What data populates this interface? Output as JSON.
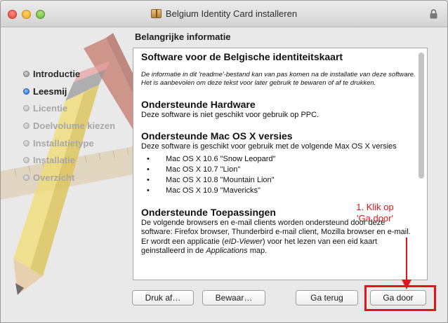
{
  "window": {
    "title": "Belgium Identity Card installeren"
  },
  "heading": "Belangrijke informatie",
  "sidebar": {
    "steps": [
      {
        "label": "Introductie",
        "state": "done"
      },
      {
        "label": "Leesmij",
        "state": "active"
      },
      {
        "label": "Licentie",
        "state": "future"
      },
      {
        "label": "Doelvolume kiezen",
        "state": "future"
      },
      {
        "label": "Installatietype",
        "state": "future"
      },
      {
        "label": "Installatie",
        "state": "future"
      },
      {
        "label": "Overzicht",
        "state": "future"
      }
    ]
  },
  "readme": {
    "title": "Software voor de Belgische identiteitskaart",
    "intro": "De informatie in dit 'readme'-bestand kan van pas komen na de installatie van deze software. Het is aanbevolen om deze tekst voor later gebruik te bewaren of af te drukken.",
    "hardware_heading": "Ondersteunde Hardware",
    "hardware_text": "Deze software is niet geschikt voor gebruik op PPC.",
    "macos_heading": "Ondersteunde Mac OS X versies",
    "macos_text": "Deze software is geschikt voor gebruik met de volgende Max OS X versies",
    "macos_versions": [
      "Mac OS X 10.6 \"Snow Leopard\"",
      "Mac OS X 10.7 \"Lion\"",
      "Mac OS X 10.8 \"Mountain Lion\"",
      "Mac OS X 10.9 \"Mavericks\""
    ],
    "apps_heading": "Ondersteunde Toepassingen",
    "apps_text": "De volgende browsers en e-mail clients worden ondersteund door deze software: Firefox browser, Thunderbird e-mail client, Mozilla browser en e-mail.",
    "apps_text2_pre": "Er wordt een applicatie (",
    "apps_text2_em": "eID-Viewer",
    "apps_text2_mid": ") voor het lezen van een eid kaart geinstalleerd in de ",
    "apps_text2_em2": "Applications",
    "apps_text2_post": " map."
  },
  "annotation": {
    "line1": "1. Klik op",
    "line2": "'Ga door'",
    "color": "#e3141c"
  },
  "buttons": {
    "print": "Druk af…",
    "save": "Bewaar…",
    "back": "Ga terug",
    "next": "Ga door"
  },
  "icons": {
    "installer": "package-icon",
    "lock": "lock-icon",
    "close": "close-icon",
    "minimize": "minimize-icon",
    "zoom": "zoom-icon"
  }
}
